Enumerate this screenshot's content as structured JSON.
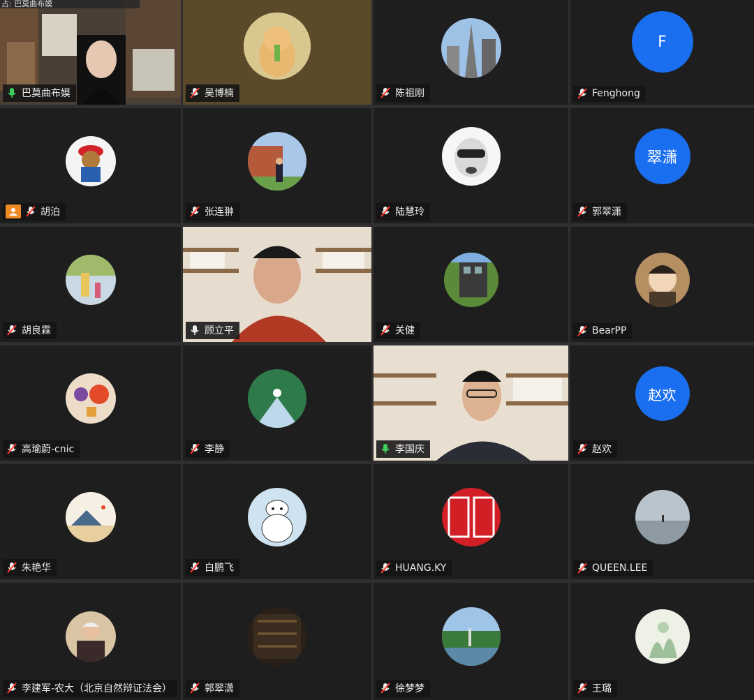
{
  "window": {
    "top_label": "占: 巴莫曲布嫫"
  },
  "participants": [
    {
      "name": "巴莫曲布嫫",
      "mic": "on",
      "kind": "video"
    },
    {
      "name": "吴博楠",
      "mic": "muted",
      "kind": "avatar"
    },
    {
      "name": "陈祖刚",
      "mic": "muted",
      "kind": "avatar"
    },
    {
      "name": "Fenghong",
      "mic": "muted",
      "kind": "letter",
      "letter": "F",
      "color": "#1a6ff0"
    },
    {
      "name": "胡泊",
      "mic": "muted",
      "kind": "avatar",
      "host": true
    },
    {
      "name": "张连翀",
      "mic": "muted",
      "kind": "avatar"
    },
    {
      "name": "陆慧玲",
      "mic": "muted",
      "kind": "avatar"
    },
    {
      "name": "郭翠潇",
      "mic": "muted",
      "kind": "letter",
      "letter": "翠潇",
      "color": "#1a6ff0"
    },
    {
      "name": "胡良霖",
      "mic": "muted",
      "kind": "avatar"
    },
    {
      "name": "顾立平",
      "mic": "on",
      "kind": "video"
    },
    {
      "name": "关健",
      "mic": "muted",
      "kind": "avatar"
    },
    {
      "name": "BearPP",
      "mic": "muted",
      "kind": "avatar"
    },
    {
      "name": "高瑜蔚-cnic",
      "mic": "muted",
      "kind": "avatar"
    },
    {
      "name": "李静",
      "mic": "muted",
      "kind": "avatar"
    },
    {
      "name": "李国庆",
      "mic": "on",
      "kind": "video"
    },
    {
      "name": "赵欢",
      "mic": "muted",
      "kind": "letter",
      "letter": "赵欢",
      "color": "#1a6ff0"
    },
    {
      "name": "朱艳华",
      "mic": "muted",
      "kind": "avatar"
    },
    {
      "name": "白鹏飞",
      "mic": "muted",
      "kind": "avatar"
    },
    {
      "name": "HUANG.KY",
      "mic": "muted",
      "kind": "avatar"
    },
    {
      "name": "QUEEN.LEE",
      "mic": "muted",
      "kind": "avatar"
    },
    {
      "name": "李建军-农大（北京自然辩证法会）",
      "mic": "muted",
      "kind": "avatar"
    },
    {
      "name": "郭翠潇",
      "mic": "muted",
      "kind": "avatar"
    },
    {
      "name": "徐梦梦",
      "mic": "muted",
      "kind": "avatar"
    },
    {
      "name": "王璐",
      "mic": "muted",
      "kind": "avatar"
    }
  ],
  "colors": {
    "mic_on": "#3ecf5a",
    "mic_muted": "#ff3b30",
    "letter_avatar": "#1a6ff0",
    "host_badge": "#f08a24"
  }
}
